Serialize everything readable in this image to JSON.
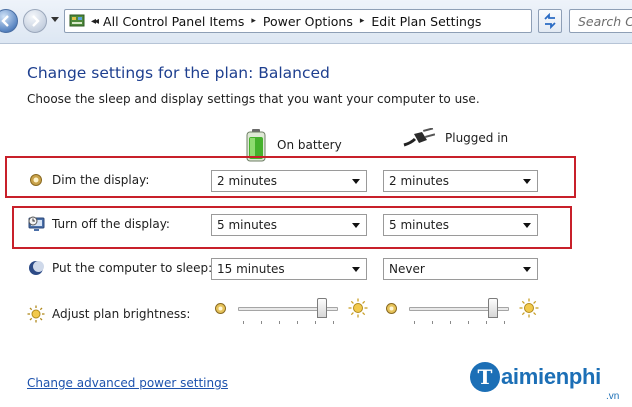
{
  "address_bar": {
    "breadcrumbs": [
      "All Control Panel Items",
      "Power Options",
      "Edit Plan Settings"
    ],
    "search_placeholder": "Search Co"
  },
  "header": {
    "title": "Change settings for the plan: Balanced",
    "subtitle": "Choose the sleep and display settings that you want your computer to use."
  },
  "columns": {
    "battery": "On battery",
    "plugged": "Plugged in"
  },
  "settings": [
    {
      "label": "Dim the display:",
      "battery": "2 minutes",
      "plugged": "2 minutes",
      "icon": "dim-display-icon"
    },
    {
      "label": "Turn off the display:",
      "battery": "5 minutes",
      "plugged": "5 minutes",
      "icon": "monitor-icon"
    },
    {
      "label": "Put the computer to sleep:",
      "battery": "15 minutes",
      "plugged": "Never",
      "icon": "moon-icon"
    }
  ],
  "brightness": {
    "label": "Adjust plan brightness:",
    "battery_level": 0.84,
    "plugged_level": 0.84
  },
  "footer": {
    "advanced_link": "Change advanced power settings"
  },
  "watermark": {
    "logo_letter": "T",
    "name": "aimienphi",
    "domain": ".vn"
  },
  "colors": {
    "title": "#1e3f8f",
    "link": "#1d52ad",
    "highlight": "#c8202a",
    "watermark": "#1c6fb6"
  }
}
